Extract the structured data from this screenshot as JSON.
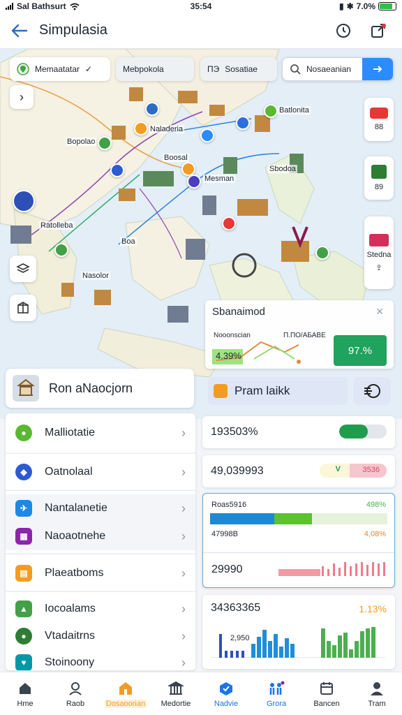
{
  "status": {
    "carrier": "Sal Bathsurt",
    "time": "35:54",
    "battery": "7.0%"
  },
  "header": {
    "title": "Simpulasia"
  },
  "filters": {
    "chip1": "Memaatatar",
    "chip2": "Mebpokola",
    "chip3_prefix": "ПЭ",
    "chip3": "Sosatiae",
    "search_value": "Nosaeanian"
  },
  "map": {
    "labels": [
      "Batlonita",
      "Naladeria",
      "Bopolao",
      "Boosal",
      "Mesman",
      "Sbodoa",
      "Ratolleba",
      "Nasolor",
      "Boa"
    ],
    "right_cards": [
      "88",
      "89",
      "Stedna"
    ]
  },
  "insight": {
    "title": "Sbanaimod",
    "left_label": "Nooonscian",
    "right_label": "П.ПО/АБАВЕ",
    "left_value": "4.39%",
    "percent": "97.%"
  },
  "location": {
    "name": "Ron aNaocjorn"
  },
  "action": {
    "label": "Pram laikk"
  },
  "list": {
    "items": [
      {
        "label": "Malliotatie",
        "icon_color": "#5bb832",
        "icon": "leaf-icon"
      },
      {
        "label": "Oatnolaal",
        "icon_color": "#2d5bd0",
        "icon": "shield-icon"
      },
      {
        "label": "Nantalanetie",
        "icon_color": "#1e88e5",
        "icon": "plane-icon"
      },
      {
        "label": "Naoaotnehe",
        "icon_color": "#8e24aa",
        "icon": "grid-icon"
      },
      {
        "label": "Plaeatboms",
        "icon_color": "#f39c21",
        "icon": "calendar-icon"
      },
      {
        "label": "Iocoalams",
        "icon_color": "#43a047",
        "icon": "triangle-icon"
      },
      {
        "label": "Vtadaitrns",
        "icon_color": "#2e7d32",
        "icon": "leaf-icon"
      },
      {
        "label": "Stoinoony",
        "icon_color": "#0097a7",
        "icon": "heart-icon"
      }
    ]
  },
  "stats": {
    "s1": {
      "value": "193503%",
      "bar_fill": 0.6
    },
    "s2": {
      "value": "49,039993",
      "check": "V",
      "badge": "3536"
    },
    "s3": {
      "label1": "Roas5916",
      "pct1": "498%",
      "label2": "47998B",
      "pct2": "4,08%",
      "value": "29990"
    },
    "s4": {
      "value": "34363365",
      "pct": "1.13%",
      "sub": "2,950"
    }
  },
  "nav": {
    "items": [
      {
        "label": "Hme",
        "icon": "home-icon"
      },
      {
        "label": "Raob",
        "icon": "profile-icon"
      },
      {
        "label": "Dosaoorian",
        "icon": "building-icon"
      },
      {
        "label": "Medortie",
        "icon": "museum-icon"
      },
      {
        "label": "Nadvie",
        "icon": "cube-icon"
      },
      {
        "label": "Grora",
        "icon": "people-icon"
      },
      {
        "label": "Bancen",
        "icon": "calendar-icon"
      },
      {
        "label": "Tram",
        "icon": "user-icon"
      }
    ]
  },
  "colors": {
    "accent": "#2a8cff",
    "green": "#1fa35d",
    "orange": "#f39c21",
    "nav_active": "#1a73e8"
  }
}
